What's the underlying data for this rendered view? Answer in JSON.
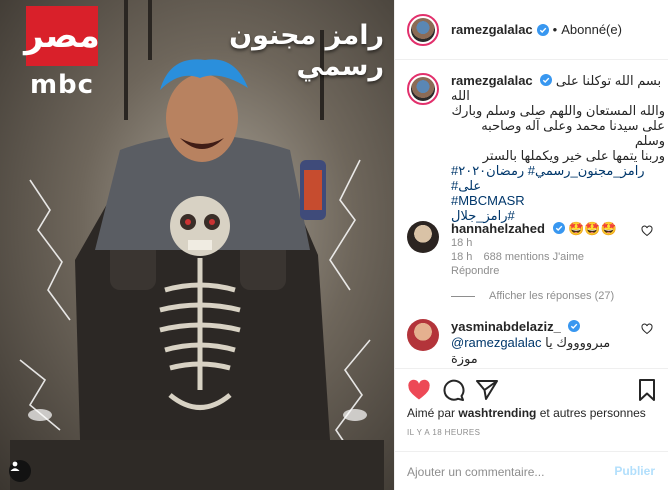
{
  "media": {
    "brand_arabic": "مصر",
    "brand_latin": "mbc",
    "show_title": "رامز مجنون رسمي"
  },
  "post": {
    "username": "ramezgalalac",
    "follow_status": "Abonné(e)",
    "separator": "•",
    "caption_lines": [
      "بسم الله توكلنا على الله",
      "والله المستعان واللهم صلى وسلم وبارك",
      "على سيدنا محمد وعلى آله وصاحبه وسلم",
      "وربنا يتمها على خير ويكملها بالستر"
    ],
    "hashtags": [
      "رامز_مجنون_رسمي# رمضان٢٠٢٠# على#",
      "#MBCMASR",
      "#رامز_جلال"
    ],
    "caption_time": "18 h"
  },
  "comments": [
    {
      "username": "hannahelzahed",
      "text": "🤩🤩🤩",
      "time": "18 h",
      "likes": "688 mentions J'aime",
      "reply_label": "Répondre"
    },
    {
      "username": "yasminabdelaziz_",
      "mention": "@ramezgalalac",
      "text": "مبرووووك يا موزة",
      "emoji": "😃"
    }
  ],
  "view_replies": "Afficher les réponses (27)",
  "actions": {
    "liked_by_prefix": "Aimé par",
    "liked_by_user": "washtrending",
    "liked_by_suffix": "et autres personnes",
    "timestamp": "IL Y A 18 HEURES"
  },
  "add_comment": {
    "placeholder": "Ajouter un commentaire...",
    "publish_label": "Publier"
  },
  "colors": {
    "like_red": "#ed4956",
    "verified_blue": "#3897f0",
    "hashtag_blue": "#00376b",
    "brand_red": "#d9202a"
  }
}
